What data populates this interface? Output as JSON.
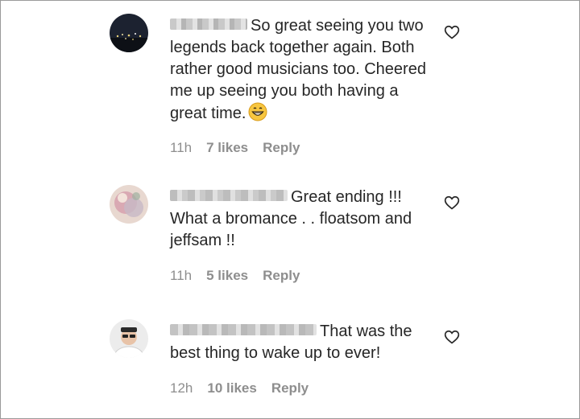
{
  "comments": [
    {
      "text": "So great seeing you two legends back together again. Both rather good musicians too. Cheered me up seeing you both having a great time.",
      "emoji": "grinning-face-icon",
      "time": "11h",
      "likes": "7 likes",
      "reply": "Reply"
    },
    {
      "text": "Great ending !!! What a bromance . . floatsom and jeffsam !!",
      "time": "11h",
      "likes": "5 likes",
      "reply": "Reply"
    },
    {
      "text": "That was the best thing to wake up to ever!",
      "time": "12h",
      "likes": "10 likes",
      "reply": "Reply"
    }
  ],
  "colors": {
    "text": "#262626",
    "meta": "#8e8e8e",
    "border": "#9a9a9a"
  }
}
